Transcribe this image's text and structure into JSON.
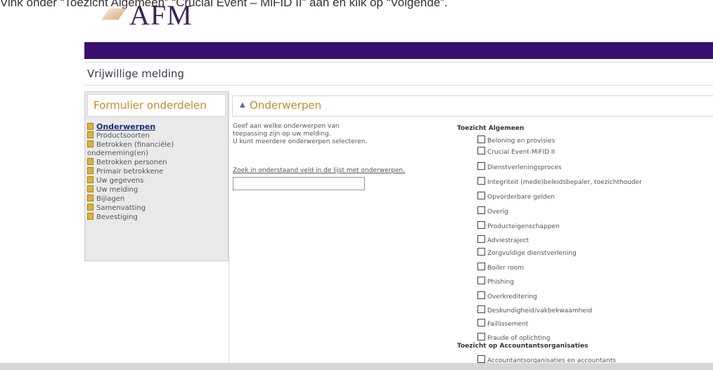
{
  "instruction": "Vink onder “Toezicht Algemeen” “Crucial Event – MiFID II” aan en klik op “Volgende”.",
  "logo_text": "AFM",
  "page_title": "Vrijwillige melding",
  "sidebar": {
    "title": "Formulier onderdelen",
    "items": [
      {
        "label": "Onderwerpen",
        "active": true
      },
      {
        "label": "Productsoorten"
      },
      {
        "label": "Betrokken (financiële) onderneming(en)"
      },
      {
        "label": "Betrokken personen"
      },
      {
        "label": "Primair betrokkene"
      },
      {
        "label": "Uw gegevens"
      },
      {
        "label": "Uw melding"
      },
      {
        "label": "Bijlagen"
      },
      {
        "label": "Samenvatting"
      },
      {
        "label": "Bevestiging"
      }
    ]
  },
  "main": {
    "section_title": "Onderwerpen",
    "description_lines": [
      "Geef aan welke onderwerpen van",
      "toepassing zijn op uw melding.",
      "U kunt meerdere onderwerpen selecteren."
    ],
    "search_hint": "Zoek in onderstaand veld in de lijst met onderwerpen.",
    "search_value": "",
    "categories": [
      {
        "title": "Toezicht Algemeen",
        "options": [
          "Beloning en provisies",
          "Crucial Event-MiFID II",
          "Dienstverleningsproces",
          "Integriteit (mede)beleidsbepaler, toezichthouder",
          "Opvorderbare gelden",
          "Overig",
          "Producteigenschappen",
          "Adviestraject",
          "Zorgvuldige dienstverlening",
          "Boiler room",
          "Phishing",
          "Overkreditering",
          "Deskundigheid/vakbekwaamheid",
          "Faillissement",
          "Fraude of oplichting"
        ]
      },
      {
        "title": "Toezicht op Accountantsorganisaties",
        "options": [
          "Accountantsorganisaties en accountants"
        ]
      }
    ]
  },
  "colors": {
    "brand_bar": "#3a0f6e",
    "heading_orange": "#c98a2c",
    "active_link": "#1b2b7a"
  }
}
